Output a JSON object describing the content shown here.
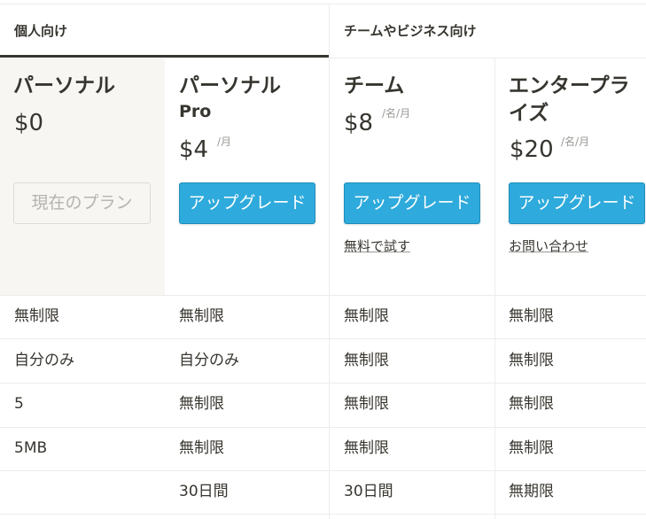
{
  "tabs": {
    "personal": "個人向け",
    "team_business": "チームやビジネス向け"
  },
  "plans": [
    {
      "name": "パーソナル",
      "name_sub": "",
      "price": "$0",
      "unit": "",
      "action": "現在のプラン",
      "link": ""
    },
    {
      "name": "パーソナル",
      "name_sub": "Pro",
      "price": "$4",
      "unit": "/月",
      "action": "アップグレード",
      "link": ""
    },
    {
      "name": "チーム",
      "name_sub": "",
      "price": "$8",
      "unit": "/名/月",
      "action": "アップグレード",
      "link": "無料で試す"
    },
    {
      "name": "エンタープラ",
      "name_sub": "イズ",
      "price": "$20",
      "unit": "/名/月",
      "action": "アップグレード",
      "link": "お問い合わせ"
    }
  ],
  "rows": [
    [
      "無制限",
      "無制限",
      "無制限",
      "無制限"
    ],
    [
      "自分のみ",
      "自分のみ",
      "無制限",
      "無制限"
    ],
    [
      "5",
      "無制限",
      "無制限",
      "無制限"
    ],
    [
      "5MB",
      "無制限",
      "無制限",
      "無制限"
    ],
    [
      "",
      "30日間",
      "30日間",
      "無期限"
    ]
  ],
  "colors": {
    "accent": "#2eaadc",
    "text": "#37352f",
    "muted": "#9b9a97",
    "current_column_bg": "#f7f6f3"
  }
}
